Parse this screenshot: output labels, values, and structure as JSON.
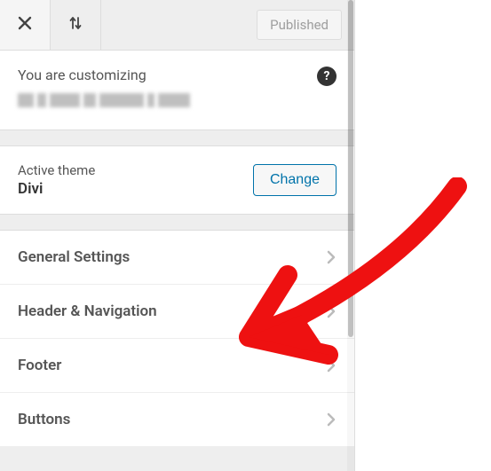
{
  "topbar": {
    "close_label": "Close",
    "controls_label": "Expand/Collapse",
    "publish_label": "Published"
  },
  "info": {
    "customizing_text": "You are customizing",
    "help_label": "?"
  },
  "theme": {
    "label": "Active theme",
    "name": "Divi",
    "change_label": "Change"
  },
  "menu": {
    "items": [
      {
        "label": "General Settings"
      },
      {
        "label": "Header & Navigation"
      },
      {
        "label": "Footer"
      },
      {
        "label": "Buttons"
      }
    ]
  }
}
